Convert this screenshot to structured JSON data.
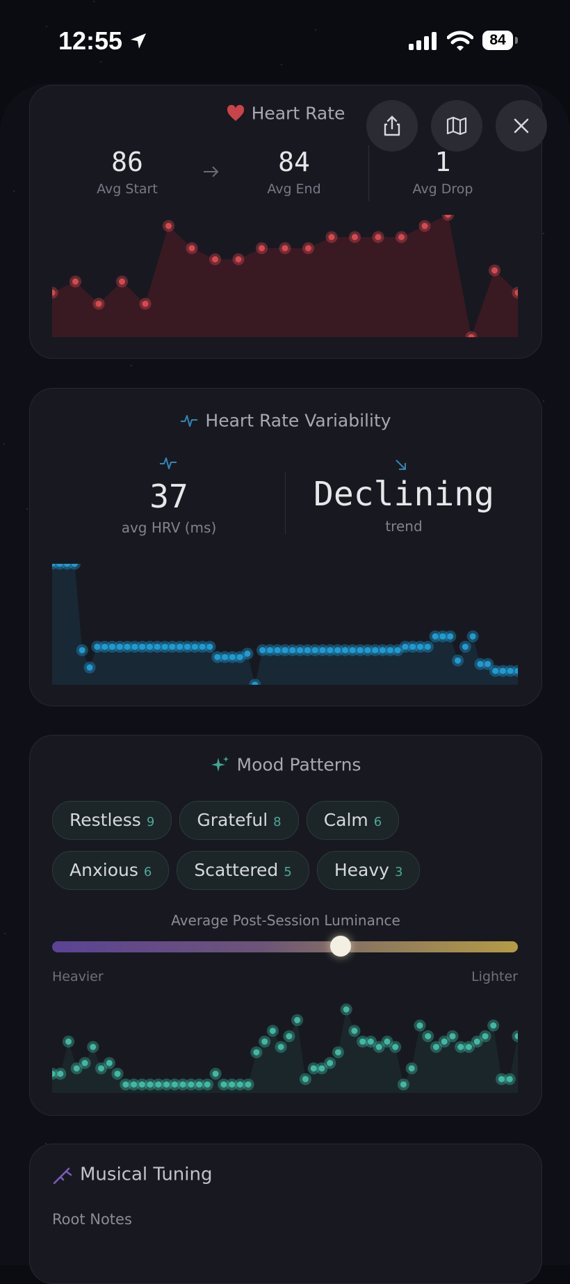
{
  "status_bar": {
    "time": "12:55",
    "battery": "84"
  },
  "heart_rate": {
    "title": "Heart Rate",
    "avg_start": "86",
    "avg_start_label": "Avg Start",
    "avg_end": "84",
    "avg_end_label": "Avg End",
    "avg_drop": "1",
    "avg_drop_label": "Avg Drop",
    "color": "#d9484f",
    "samples": [
      87,
      88,
      86,
      88,
      86,
      93,
      91,
      90,
      90,
      91,
      91,
      91,
      92,
      92,
      92,
      92,
      93,
      94,
      83,
      89,
      87
    ]
  },
  "hrv": {
    "title": "Heart Rate Variability",
    "avg_value": "37",
    "avg_label": "avg HRV (ms)",
    "trend_value": "Declining",
    "trend_label": "trend",
    "color": "#1f9bd3",
    "samples": [
      62,
      62,
      62,
      62,
      37,
      32,
      38,
      38,
      38,
      38,
      38,
      38,
      38,
      38,
      38,
      38,
      38,
      38,
      38,
      38,
      38,
      38,
      35,
      35,
      35,
      35,
      36,
      27,
      37,
      37,
      37,
      37,
      37,
      37,
      37,
      37,
      37,
      37,
      37,
      37,
      37,
      37,
      37,
      37,
      37,
      37,
      37,
      38,
      38,
      38,
      38,
      41,
      41,
      41,
      34,
      38,
      41,
      33,
      33,
      31,
      31,
      31,
      31
    ]
  },
  "mood": {
    "title": "Mood Patterns",
    "chips": [
      {
        "label": "Restless",
        "count": "9"
      },
      {
        "label": "Grateful",
        "count": "8"
      },
      {
        "label": "Calm",
        "count": "6"
      },
      {
        "label": "Anxious",
        "count": "6"
      },
      {
        "label": "Scattered",
        "count": "5"
      },
      {
        "label": "Heavy",
        "count": "3"
      }
    ],
    "luminance_label": "Average Post-Session Luminance",
    "luminance_value": 0.62,
    "left_label": "Heavier",
    "right_label": "Lighter",
    "color": "#3fb9a2",
    "samples": [
      44,
      44,
      50,
      45,
      46,
      49,
      45,
      46,
      44,
      42,
      42,
      42,
      42,
      42,
      42,
      42,
      42,
      42,
      42,
      42,
      44,
      42,
      42,
      42,
      42,
      48,
      50,
      52,
      49,
      51,
      54,
      43,
      45,
      45,
      46,
      48,
      56,
      52,
      50,
      50,
      49,
      50,
      49,
      42,
      45,
      53,
      51,
      49,
      50,
      51,
      49,
      49,
      50,
      51,
      53,
      43,
      43,
      51
    ]
  },
  "musical_tuning": {
    "title": "Musical Tuning",
    "root_notes_label": "Root Notes"
  }
}
